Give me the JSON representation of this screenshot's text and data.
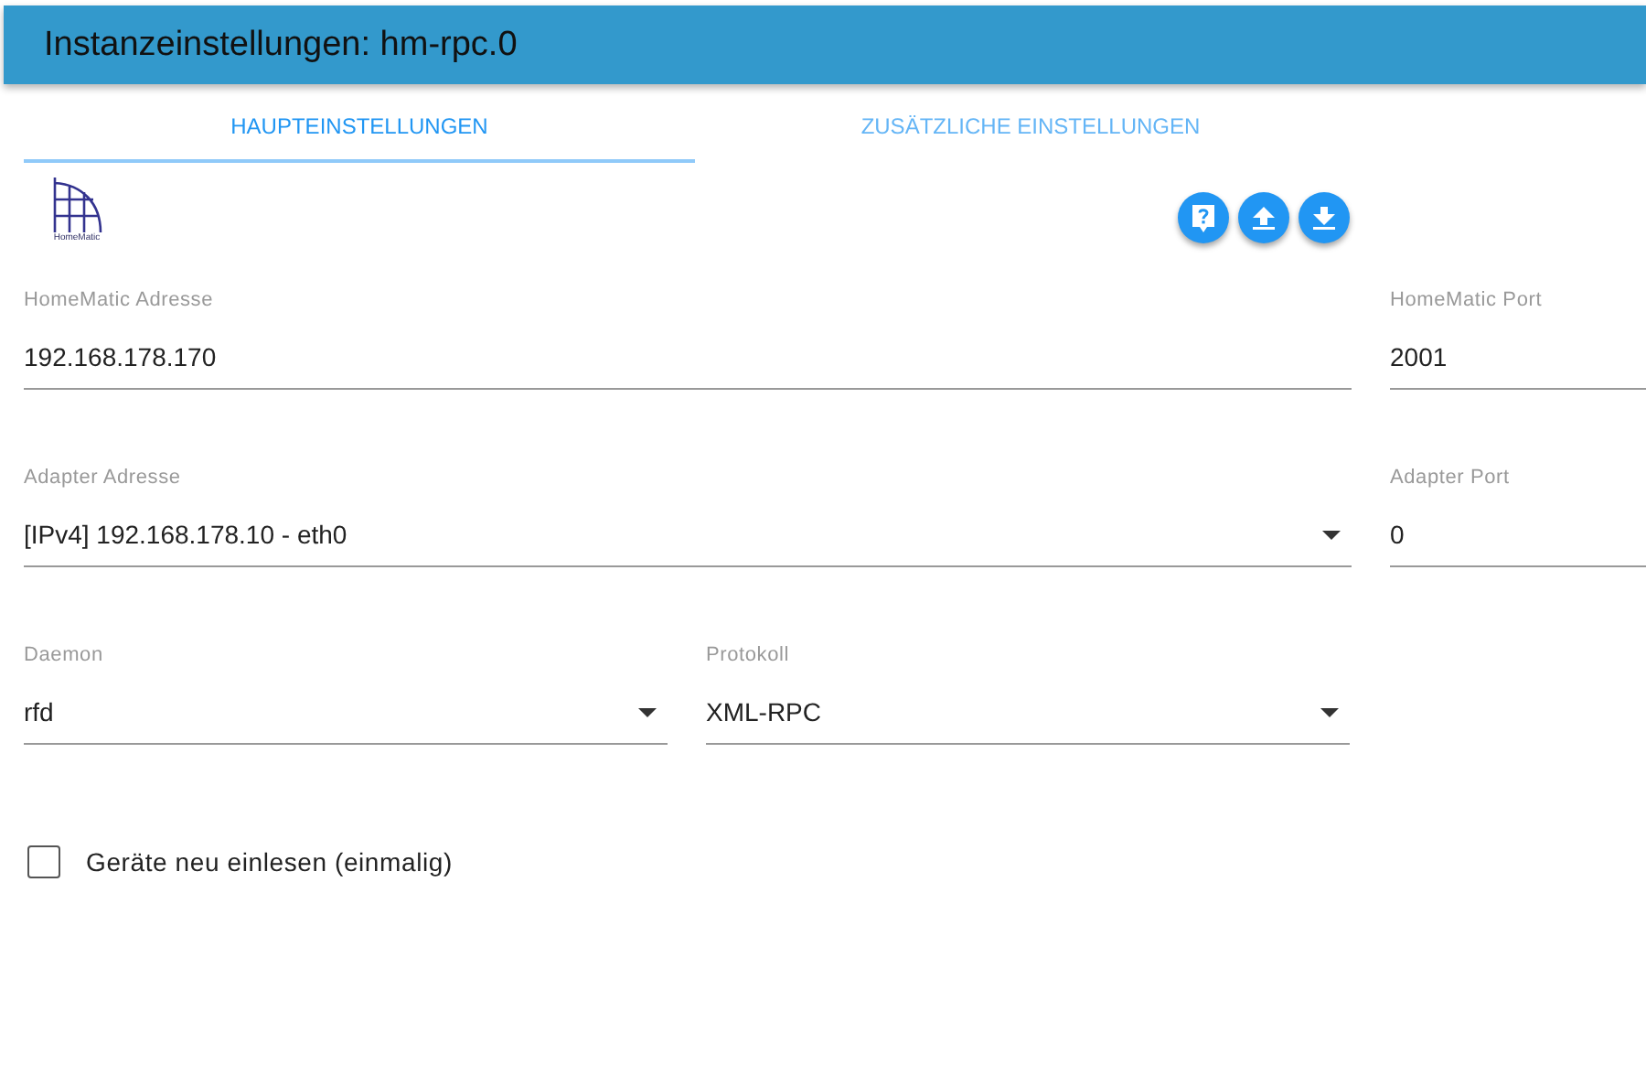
{
  "window": {
    "title": "Instanzeinstellungen: hm-rpc.0"
  },
  "tabs": [
    {
      "label": "HAUPTEINSTELLUNGEN",
      "selected": true
    },
    {
      "label": "ZUSÄTZLICHE EINSTELLUNGEN",
      "selected": false
    }
  ],
  "logo": {
    "text": "HomeMatic"
  },
  "actions": [
    {
      "kind": "help"
    },
    {
      "kind": "upload"
    },
    {
      "kind": "download"
    }
  ],
  "field_rows": [
    [
      {
        "label": "HomeMatic Adresse",
        "value": "192.168.178.170",
        "kind": "text"
      },
      {
        "label": "HomeMatic Port",
        "value": "2001",
        "kind": "text"
      }
    ],
    [
      {
        "label": "Adapter Adresse",
        "value": "[IPv4] 192.168.178.10 - eth0",
        "kind": "select"
      },
      {
        "label": "Adapter Port",
        "value": "0",
        "kind": "text"
      }
    ],
    [
      {
        "label": "Daemon",
        "value": "rfd",
        "kind": "select"
      },
      {
        "label": "Protokoll",
        "value": "XML-RPC",
        "kind": "select"
      }
    ]
  ],
  "checkbox": {
    "label": "Geräte neu einlesen (einmalig)",
    "checked": false
  }
}
